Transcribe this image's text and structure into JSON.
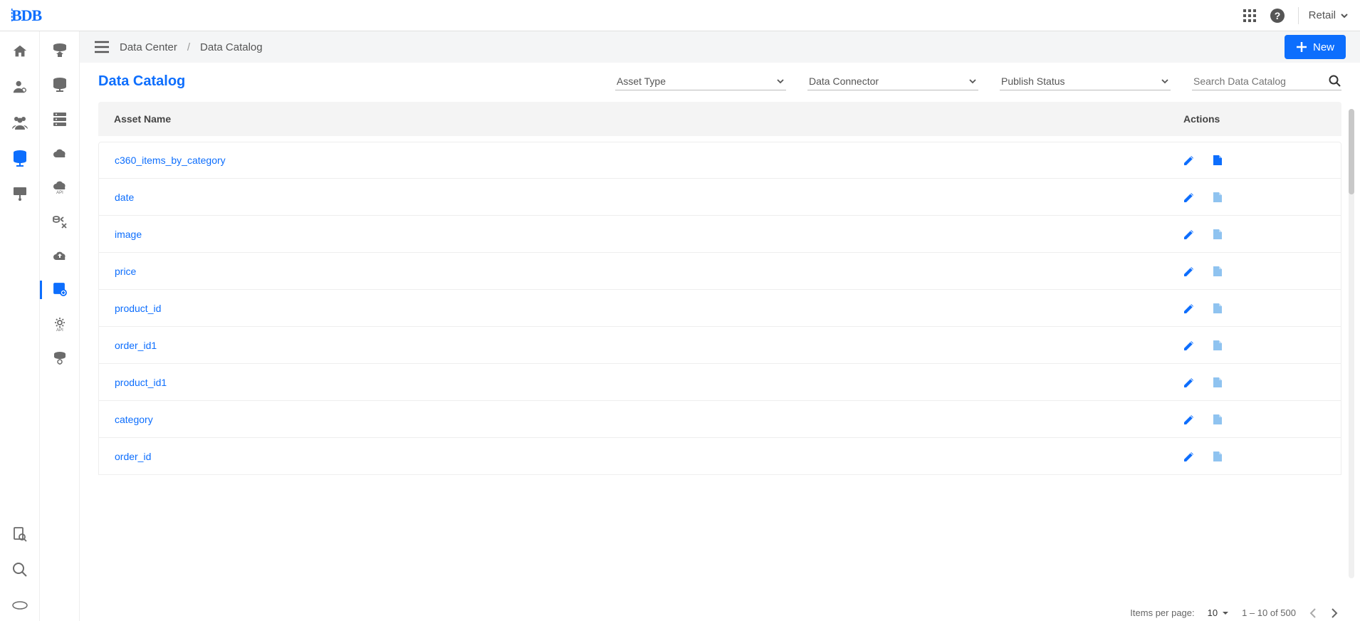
{
  "topbar": {
    "retail_label": "Retail"
  },
  "breadcrumb": {
    "parent": "Data Center",
    "current": "Data Catalog"
  },
  "new_button_label": "New",
  "page_title": "Data Catalog",
  "filters": {
    "asset_type": "Asset Type",
    "data_connector": "Data Connector",
    "publish_status": "Publish Status"
  },
  "search": {
    "placeholder": "Search Data Catalog"
  },
  "table": {
    "header_name": "Asset Name",
    "header_actions": "Actions",
    "rows": [
      {
        "name": "c360_items_by_category",
        "doc_dim": false
      },
      {
        "name": "date",
        "doc_dim": true
      },
      {
        "name": "image",
        "doc_dim": true
      },
      {
        "name": "price",
        "doc_dim": true
      },
      {
        "name": "product_id",
        "doc_dim": true
      },
      {
        "name": "order_id1",
        "doc_dim": true
      },
      {
        "name": "product_id1",
        "doc_dim": true
      },
      {
        "name": "category",
        "doc_dim": true
      },
      {
        "name": "order_id",
        "doc_dim": true
      }
    ]
  },
  "pager": {
    "label": "Items per page:",
    "page_size": "10",
    "range": "1 – 10 of 500"
  }
}
